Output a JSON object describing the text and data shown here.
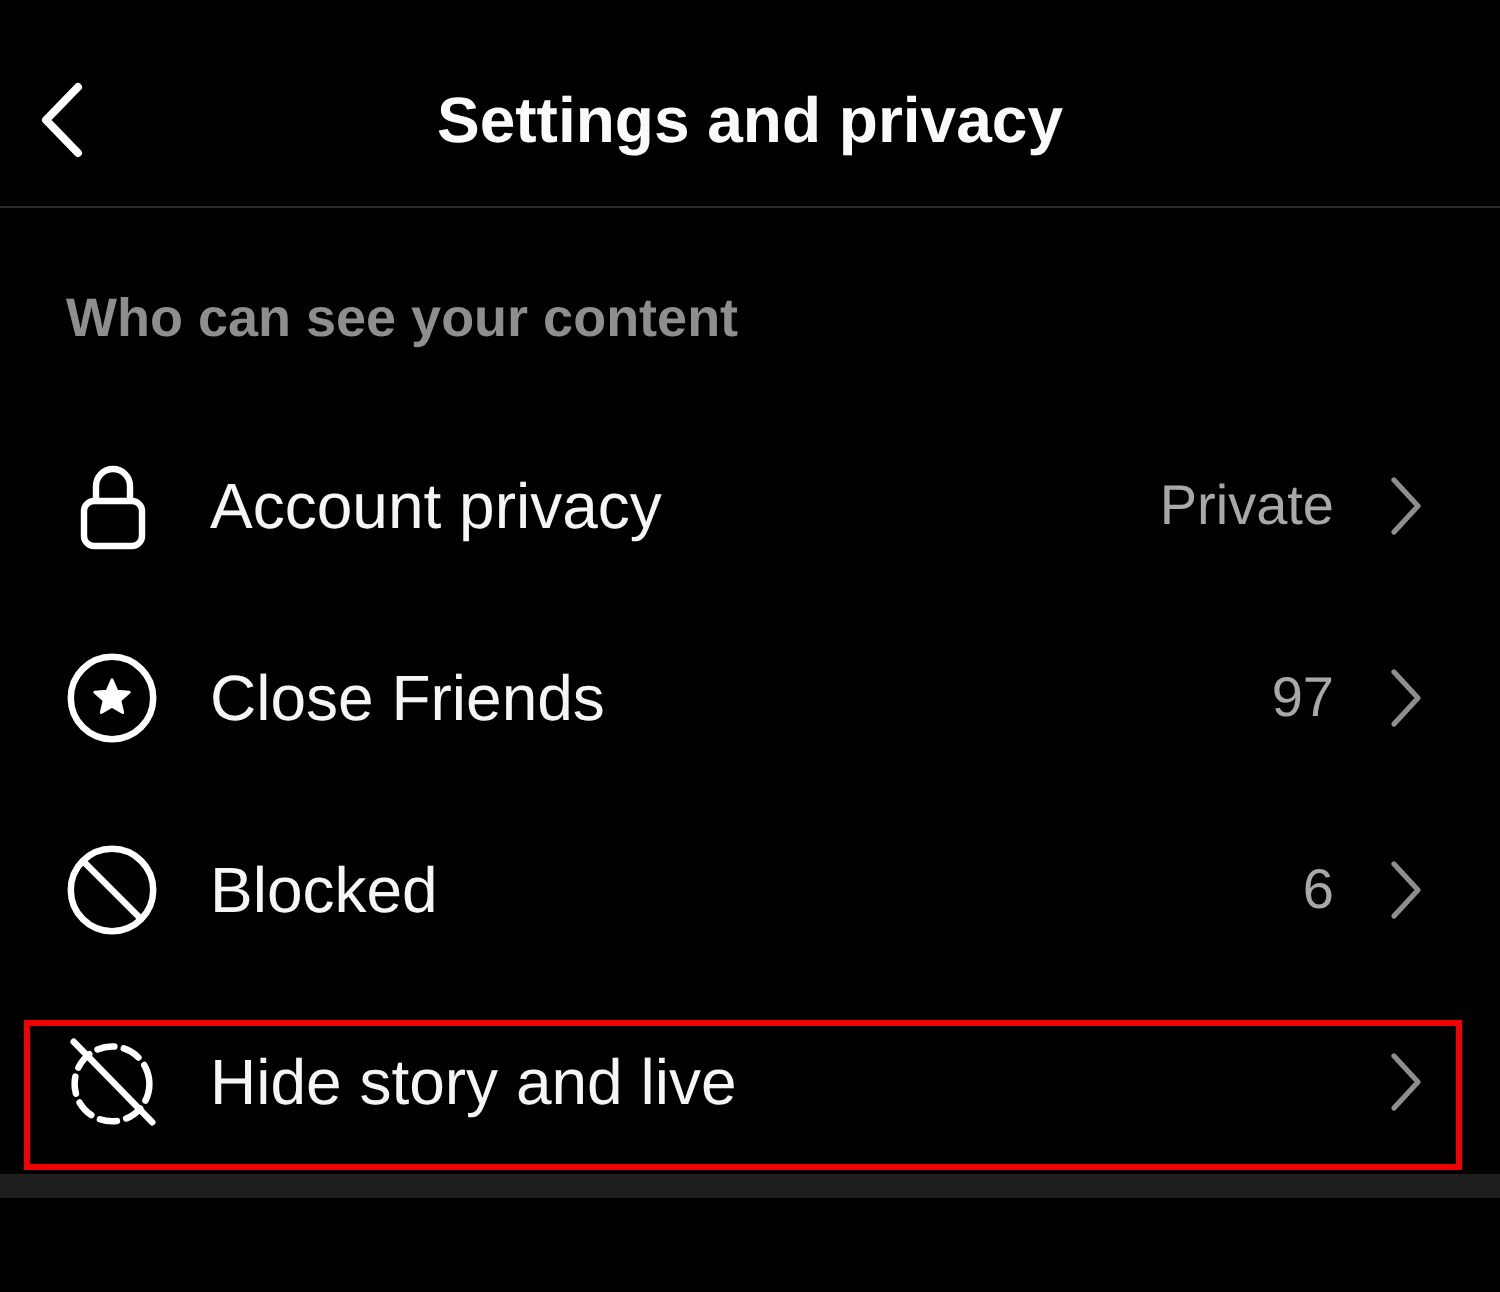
{
  "header": {
    "title": "Settings and privacy"
  },
  "section": {
    "heading": "Who can see your content"
  },
  "rows": [
    {
      "label": "Account privacy",
      "value": "Private",
      "highlighted": false
    },
    {
      "label": "Close Friends",
      "value": "97",
      "highlighted": false
    },
    {
      "label": "Blocked",
      "value": "6",
      "highlighted": false
    },
    {
      "label": "Hide story and live",
      "highlighted": true
    }
  ]
}
